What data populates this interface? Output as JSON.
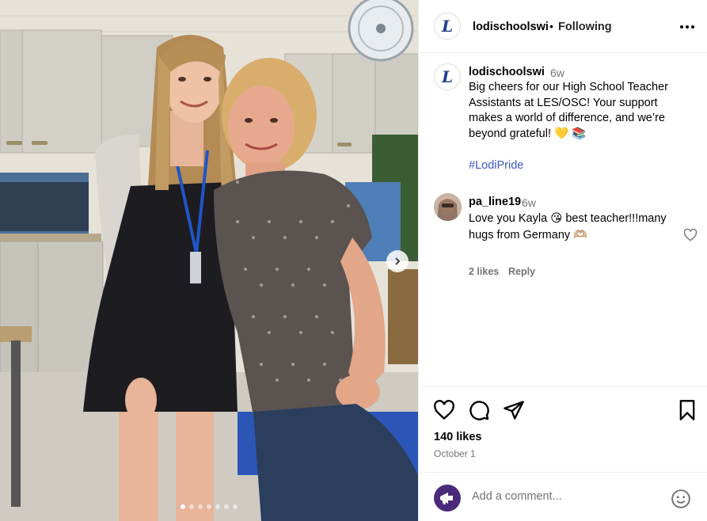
{
  "photo": {
    "carousel_total": 7,
    "carousel_active": 1
  },
  "header": {
    "username": "lodischoolswi",
    "separator": "•",
    "follow_status": "Following",
    "avatar_letter": "L"
  },
  "caption": {
    "username": "lodischoolswi",
    "time": "6w",
    "text": "Big cheers for our High School Teacher Assistants at LES/OSC! Your support makes a world of difference, and we’re beyond grateful!",
    "emojis": "💛 📚",
    "hashtag": "#LodiPride"
  },
  "comment": {
    "username": "pa_line19",
    "time": "6w",
    "text_part1": "Love you Kayla",
    "emoji1": "😘",
    "text_part2": "best teacher!!!many hugs from Germany",
    "emoji2": "🫶🏼",
    "likes": "2 likes",
    "reply": "Reply"
  },
  "actions": {
    "likes": "140 likes",
    "date": "October 1"
  },
  "add_comment": {
    "placeholder": "Add a comment..."
  },
  "icons": [
    "more-icon",
    "heart-icon",
    "comment-icon",
    "share-icon",
    "bookmark-icon",
    "emoji-icon",
    "chevron-right-icon"
  ]
}
